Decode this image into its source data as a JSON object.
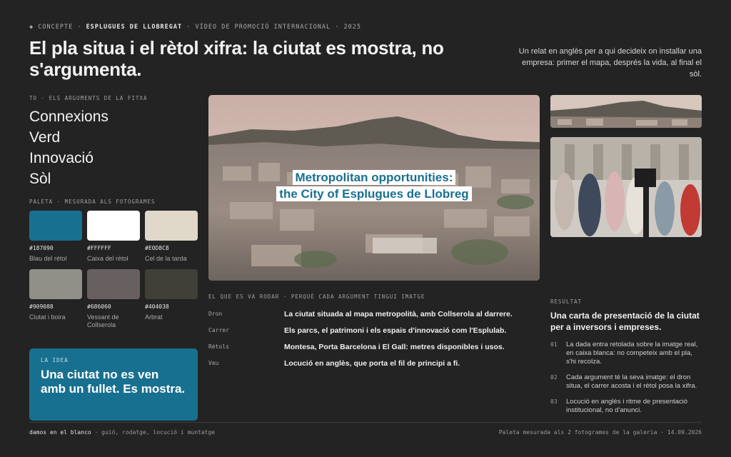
{
  "eyebrow": {
    "bullet": "◆",
    "part1": "CONCEPTE",
    "sep1": " · ",
    "part2": "ESPLUGUES DE LLOBREGAT",
    "sep2": " · ",
    "part3": "VÍDEO DE PROMOCIÓ INTERNACIONAL",
    "sep3": " · ",
    "part4": "2025"
  },
  "headline": "El pla situa i el rètol xifra: la ciutat es mostra, no s'argumenta.",
  "intro": "Un relat en anglès per a qui decideix on installar una empresa: primer el mapa, després la vida, al final el sòl.",
  "arguments": {
    "label": "TO · ELS ARGUMENTS DE LA FITXA",
    "items": [
      "Connexions",
      "Verd",
      "Innovació",
      "Sòl"
    ]
  },
  "palette": {
    "label": "PALETA · MESURADA ALS FOTOGRAMES",
    "swatches": [
      {
        "hex": "#187090",
        "name": "Blau del rètol"
      },
      {
        "hex": "#FFFFFF",
        "name": "Caixa del rètol"
      },
      {
        "hex": "#E0D8C8",
        "name": "Cel de la tarda"
      },
      {
        "hex": "#909088",
        "name": "Ciutat i boira"
      },
      {
        "hex": "#686060",
        "name": "Vessant de Collserola"
      },
      {
        "hex": "#404038",
        "name": "Arbrat"
      }
    ]
  },
  "idea": {
    "label": "LA IDEA",
    "text": "Una ciutat no es ven amb un fullet. Es mostra."
  },
  "main_photo": {
    "title_line1": "Metropolitan opportunities:",
    "title_line2": "the City of Esplugues de Llobreg"
  },
  "shoot": {
    "label": "EL QUE ES VA RODAR · PERQUÈ CADA ARGUMENT TINGUI IMATGE",
    "rows": [
      {
        "key": "Dron",
        "value": "La ciutat situada al mapa metropolità, amb Collserola al darrere."
      },
      {
        "key": "Carrer",
        "value": "Els parcs, el patrimoni i els espais d'innovació com l'Esplulab."
      },
      {
        "key": "Rètols",
        "value": "Montesa, Porta Barcelona i El Gall: metres disponibles i usos."
      },
      {
        "key": "Veu",
        "value": "Locució en anglès, que porta el fil de principi a fi."
      }
    ]
  },
  "result": {
    "label": "RESULTAT",
    "title": "Una carta de presentació de la ciutat per a inversors i empreses.",
    "items": [
      {
        "num": "01",
        "text": "La dada entra retolada sobre la imatge real, en caixa blanca: no competeix amb el pla, s'hi recolza."
      },
      {
        "num": "02",
        "text": "Cada argument té la seva imatge: el dron situa, el carrer acosta i el rètol posa la xifra."
      },
      {
        "num": "03",
        "text": "Locució en anglès i ritme de presentació institucional, no d'anunci."
      }
    ]
  },
  "footer": {
    "brand": "damos en el blanco",
    "services": " · guió, rodatge, locució i muntatge",
    "right": "Paleta mesurada als 2 fotogrames de la galeria · 14.09.2026"
  }
}
